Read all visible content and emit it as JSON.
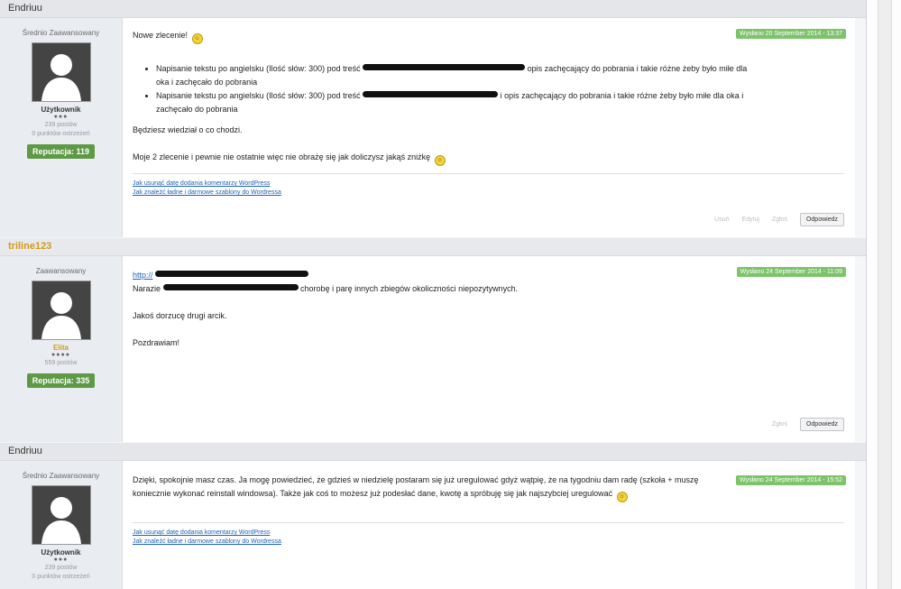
{
  "posts": [
    {
      "author": "Endriuu",
      "rank": "Średnio Zaawansowany",
      "role": "Użytkownik",
      "pips": "●●●",
      "posts_count": "239 postów",
      "warnings": "0 punktów ostrzeżeń",
      "reputation": "Reputacja: 119",
      "date": "Wysłano 20 September 2014 - 13:37",
      "intro": "Nowe zlecenie!",
      "bullets": [
        {
          "a": "Napisanie tekstu po angielsku (Ilość słów: 300) pod treść",
          "b": "opis zachęcający do pobrania i takie różne żeby było miłe dla oka i zachęcało do pobrania"
        },
        {
          "a": "Napisanie tekstu po angielsku (Ilość słów: 300) pod treść",
          "b": "i opis zachęcający do pobrania i takie różne żeby było miłe dla oka i zachęcało do pobrania"
        }
      ],
      "line2": "Będziesz wiedział o co chodzi.",
      "line3": "Moje 2 zlecenie i pewnie nie ostatnie więc nie obrażę się jak doliczysz jakąś zniżkę",
      "sig_links": [
        "Jak usunąć datę dodania komentarzy WordPress",
        "Jak znaleźć ładne i darmowe szablony do Wordressa"
      ],
      "actions": [
        "Usuń",
        "Edytuj",
        "Zgłoś"
      ],
      "reply": "Odpowiedz"
    },
    {
      "author": "triline123",
      "rank": "Zaawansowany",
      "role": "Elita",
      "pips": "●●●●",
      "posts_count": "559 postów",
      "reputation": "Reputacja: 335",
      "date": "Wysłano 24 September 2014 - 11:09",
      "link_text": "http://",
      "line1_end": "chorobę i parę innych zbiegów okoliczności niepozytywnych.",
      "line1_start": "Narazie",
      "line2": "Jakoś dorzucę drugi arcik.",
      "line3": "Pozdrawiam!",
      "actions": [
        "Zgłoś"
      ],
      "reply": "Odpowiedz"
    },
    {
      "author": "Endriuu",
      "rank": "Średnio Zaawansowany",
      "role": "Użytkownik",
      "pips": "●●●",
      "posts_count": "239 postów",
      "warnings": "0 punktów ostrzeżeń",
      "date": "Wysłano 24 September 2014 - 15:52",
      "body": "Dzięki, spokojnie masz czas. Ja mogę powiedzieć, że gdzieś w niedzielę postaram się już uregulować gdyż wątpię, że na tygodniu dam radę (szkoła + muszę koniecznie wykonać reinstall windowsa). Także jak coś to możesz już podesłać dane, kwotę a spróbuję się jak najszybciej uregulować",
      "sig_links": [
        "Jak usunąć datę dodania komentarzy WordPress",
        "Jak znaleźć ładne i darmowe szablony do Wordressa"
      ]
    }
  ]
}
